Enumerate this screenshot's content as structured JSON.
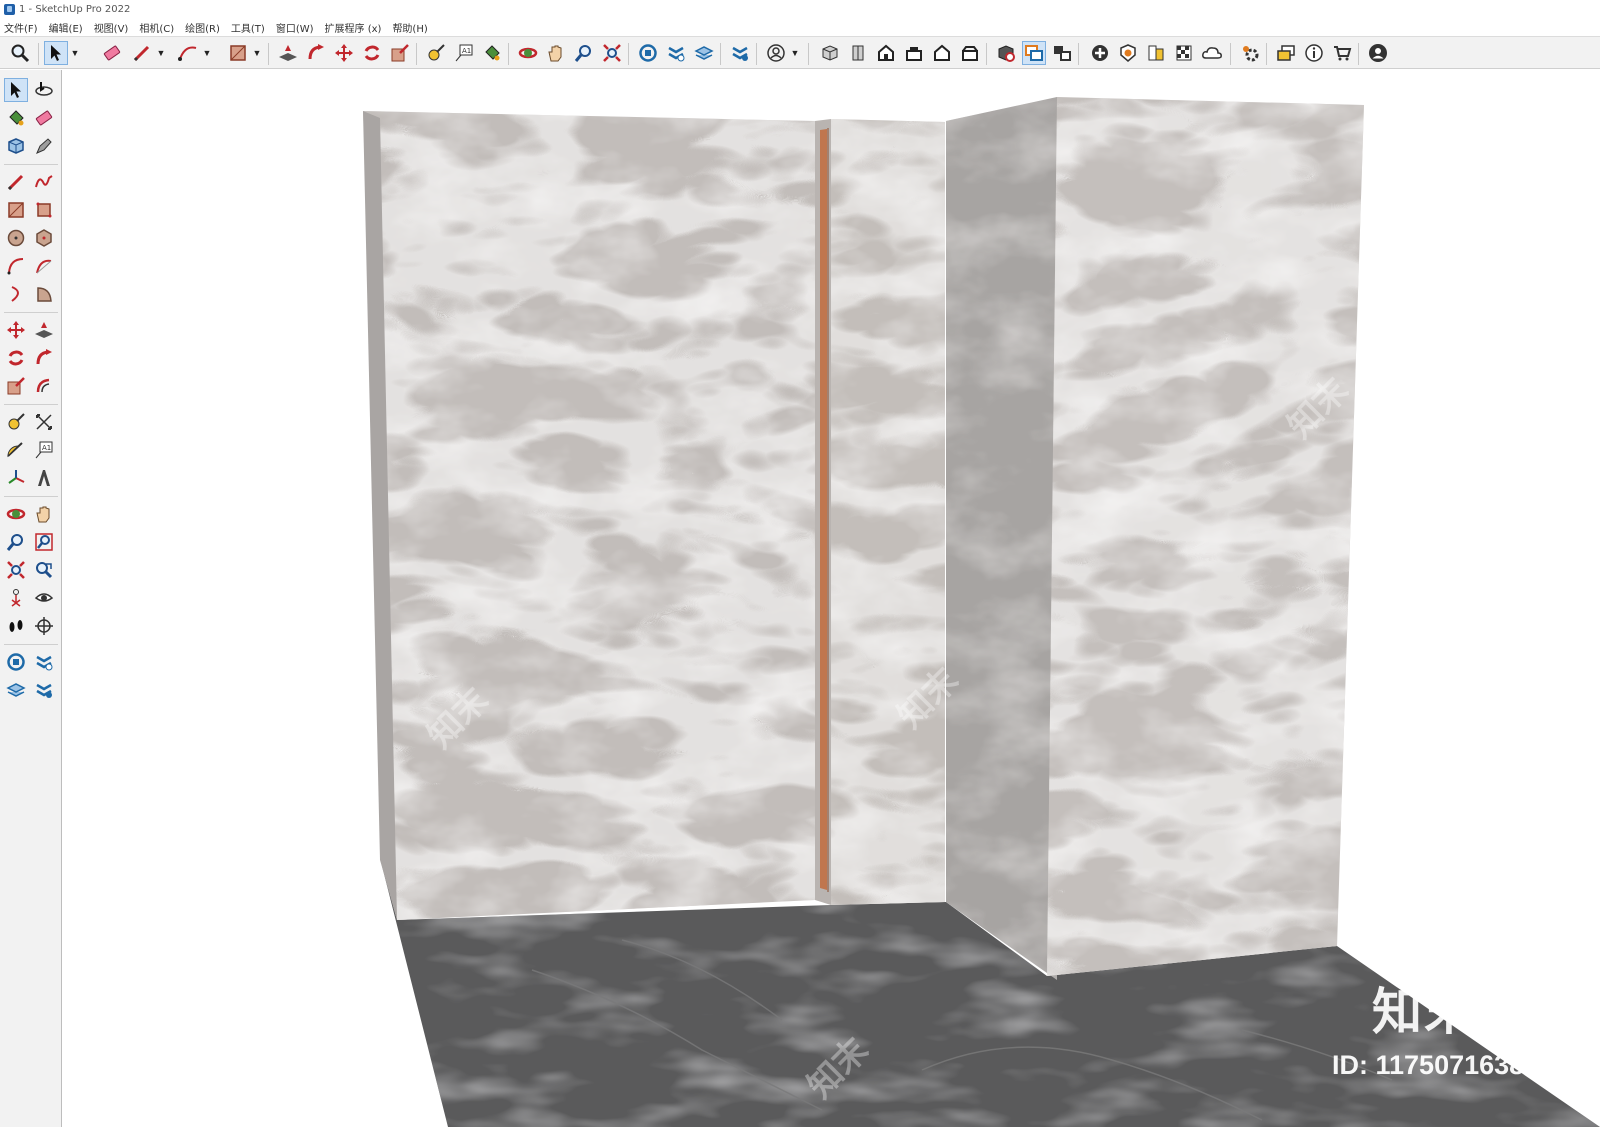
{
  "window": {
    "title": "1 - SketchUp Pro 2022"
  },
  "menu": [
    "文件(F)",
    "编辑(E)",
    "视图(V)",
    "相机(C)",
    "绘图(R)",
    "工具(T)",
    "窗口(W)",
    "扩展程序 (x)",
    "帮助(H)"
  ],
  "icons": {
    "top": [
      "zoom-icon",
      "select-icon",
      "eraser-icon",
      "pencil-line-icon",
      "arc-icon",
      "rectangle-icon",
      "push-pull-icon",
      "follow-me-icon",
      "move-icon",
      "rotate-icon",
      "scale-icon",
      "tape-measure-icon",
      "text-icon",
      "paint-bucket-icon",
      "orbit-icon",
      "pan-icon",
      "zoom-window-icon",
      "zoom-extents-icon",
      "3d-warehouse-icon",
      "extension-warehouse-icon",
      "layout-icon",
      "extension-manager-icon",
      "account-icon",
      "iso-view-icon",
      "top-view-icon",
      "front-view-icon",
      "right-view-icon",
      "back-view-icon",
      "left-view-icon",
      "xray-icon",
      "components-icon",
      "groups-icon",
      "add-location-icon",
      "shadows-icon",
      "styles-icon",
      "materials-icon",
      "cloud-icon",
      "settings-icon",
      "scenes-icon",
      "info-icon",
      "cart-icon",
      "profile-icon"
    ],
    "left": [
      "select-icon",
      "orbit-icon",
      "paint-bucket-icon",
      "eraser-icon",
      "component-icon",
      "tape-icon",
      "pencil-icon",
      "freehand-icon",
      "rectangle-icon",
      "rotated-rectangle-icon",
      "circle-icon",
      "polygon-icon",
      "arc-icon",
      "two-point-arc-icon",
      "three-point-arc-icon",
      "pie-icon",
      "move-icon",
      "push-pull-icon",
      "rotate-icon",
      "follow-me-icon",
      "scale-icon",
      "offset-icon",
      "tape-measure-icon",
      "dimension-icon",
      "protractor-icon",
      "text-icon",
      "axes-icon",
      "3d-text-icon",
      "orbit-tool-icon",
      "pan-icon",
      "zoom-icon",
      "zoom-window-icon",
      "zoom-extents-icon",
      "previous-view-icon",
      "position-camera-icon",
      "look-around-icon",
      "walk-icon",
      "section-plane-icon",
      "warehouse-icon",
      "extension-icon",
      "layout-icon",
      "manager-icon"
    ]
  },
  "colors": {
    "accent": "#cfe3f7",
    "wall_light": "#c2bdba",
    "wall_side": "#a7a4a2",
    "floor": "#5a5a5b",
    "copper_strip": "#c0764e"
  },
  "watermark": {
    "brand": "知末",
    "id_text": "ID: 1175071638"
  }
}
